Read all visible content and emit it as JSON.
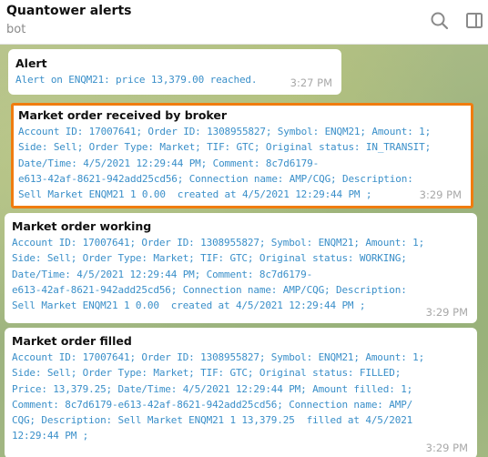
{
  "header": {
    "title": "Quantower alerts",
    "subtitle": "bot",
    "search_icon": "search-icon",
    "sidebar_icon": "sidebar-toggle-icon"
  },
  "messages": [
    {
      "title": "Alert",
      "lines": [
        "Alert on ENQM21: price 13,379.00 reached."
      ],
      "time": "3:27 PM"
    },
    {
      "title": "Market order received by broker",
      "lines": [
        "Account ID: 17007641; Order ID: 1308955827; Symbol: ENQM21; Amount: 1;",
        "Side: Sell; Order Type: Market; TIF: GTC; Original status: IN_TRANSIT;",
        "Date/Time: 4/5/2021 12:29:44 PM; Comment: 8c7d6179-",
        "e613-42af-8621-942add25cd56; Connection name: AMP/CQG; Description:",
        "Sell Market ENQM21 1 0.00  created at 4/5/2021 12:29:44 PM ;"
      ],
      "time": "3:29 PM",
      "highlight_color": "#f07c0f"
    },
    {
      "title": "Market order working",
      "lines": [
        "Account ID: 17007641; Order ID: 1308955827; Symbol: ENQM21; Amount: 1;",
        "Side: Sell; Order Type: Market; TIF: GTC; Original status: WORKING;",
        "Date/Time: 4/5/2021 12:29:44 PM; Comment: 8c7d6179-",
        "e613-42af-8621-942add25cd56; Connection name: AMP/CQG; Description:",
        "Sell Market ENQM21 1 0.00  created at 4/5/2021 12:29:44 PM ;"
      ],
      "time": "3:29 PM"
    },
    {
      "title": "Market order filled",
      "lines": [
        "Account ID: 17007641; Order ID: 1308955827; Symbol: ENQM21; Amount: 1;",
        "Side: Sell; Order Type: Market; TIF: GTC; Original status: FILLED;",
        "Price: 13,379.25; Date/Time: 4/5/2021 12:29:44 PM; Amount filled: 1;",
        "Comment: 8c7d6179-e613-42af-8621-942add25cd56; Connection name: AMP/",
        "CQG; Description: Sell Market ENQM21 1 13,379.25  filled at 4/5/2021",
        "12:29:44 PM ;"
      ],
      "time": "3:29 PM"
    }
  ],
  "colors": {
    "body_text": "#3a8fc9",
    "time_text": "#a8a8a8",
    "wallpaper": "#a9b98a"
  }
}
